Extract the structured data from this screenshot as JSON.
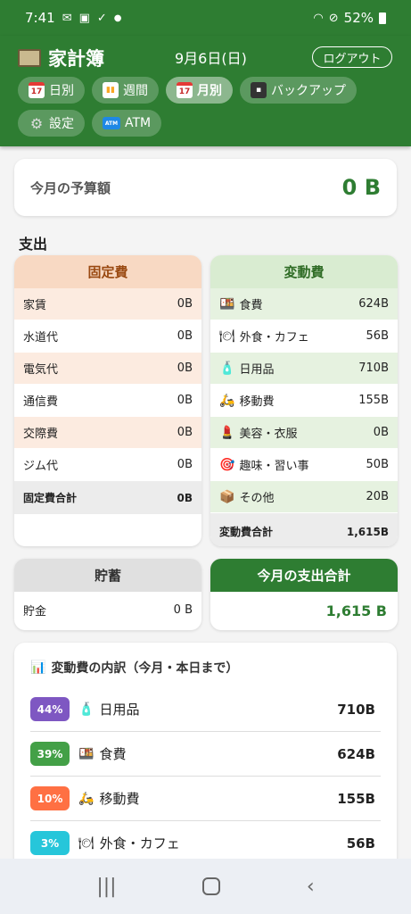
{
  "status": {
    "time": "7:41",
    "battery": "52%"
  },
  "header": {
    "title": "家計簿",
    "date": "9月6日(日)",
    "logout": "ログアウト",
    "nav": [
      "日別",
      "週間",
      "月別",
      "バックアップ",
      "設定",
      "ATM"
    ]
  },
  "budget": {
    "label": "今月の予算額",
    "value": "0 B"
  },
  "expense_title": "支出",
  "fixed": {
    "title": "固定費",
    "items": [
      {
        "name": "家賃",
        "value": "0B"
      },
      {
        "name": "水道代",
        "value": "0B"
      },
      {
        "name": "電気代",
        "value": "0B"
      },
      {
        "name": "通信費",
        "value": "0B"
      },
      {
        "name": "交際費",
        "value": "0B"
      },
      {
        "name": "ジム代",
        "value": "0B"
      }
    ],
    "total_label": "固定費合計",
    "total": "0B"
  },
  "variable": {
    "title": "変動費",
    "items": [
      {
        "name": "食費",
        "value": "624B",
        "icon": "bento-icon"
      },
      {
        "name": "外食・カフェ",
        "value": "56B",
        "icon": "plate-icon"
      },
      {
        "name": "日用品",
        "value": "710B",
        "icon": "bottle-icon"
      },
      {
        "name": "移動費",
        "value": "155B",
        "icon": "scooter-icon"
      },
      {
        "name": "美容・衣服",
        "value": "0B",
        "icon": "lipstick-icon"
      },
      {
        "name": "趣味・習い事",
        "value": "50B",
        "icon": "target-icon"
      },
      {
        "name": "その他",
        "value": "20B",
        "icon": "package-icon"
      }
    ],
    "total_label": "変動費合計",
    "total": "1,615B"
  },
  "savings": {
    "title": "貯蓄",
    "label": "貯金",
    "value": "0 B"
  },
  "month_total": {
    "title": "今月の支出合計",
    "value": "1,615 B"
  },
  "breakdown": {
    "title": "変動費の内訳（今月・本日まで）",
    "rows": [
      {
        "pct": "44%",
        "name": "日用品",
        "value": "710B",
        "color": "#7e57c2"
      },
      {
        "pct": "39%",
        "name": "食費",
        "value": "624B",
        "color": "#43a047"
      },
      {
        "pct": "10%",
        "name": "移動費",
        "value": "155B",
        "color": "#ff7043"
      },
      {
        "pct": "3%",
        "name": "外食・カフェ",
        "value": "56B",
        "color": "#26c6da"
      }
    ]
  }
}
